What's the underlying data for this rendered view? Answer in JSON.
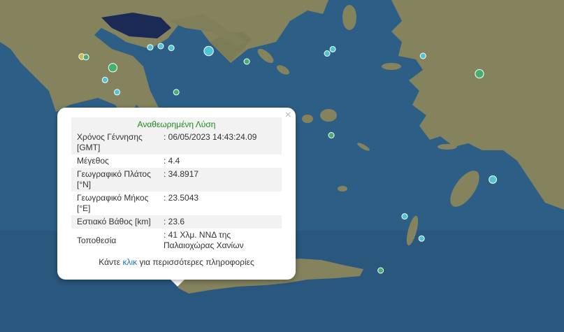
{
  "map": {
    "sea_color": "#2d5f86",
    "land_color": "#8a8863",
    "land_dark_color": "#6e7450"
  },
  "markers": [
    {
      "lon": 22.96,
      "lat": 38.17,
      "color": "#4ec4d8",
      "mag": 3.6
    },
    {
      "lon": 22.13,
      "lat": 38.23,
      "color": "#4ec4d8",
      "mag": 2.6
    },
    {
      "lon": 22.28,
      "lat": 38.25,
      "color": "#4ec4d8",
      "mag": 2.4
    },
    {
      "lon": 22.43,
      "lat": 38.22,
      "color": "#4ec4d8",
      "mag": 2.4
    },
    {
      "lon": 21.16,
      "lat": 38.08,
      "color": "#c8b84a",
      "mag": 2.8
    },
    {
      "lon": 21.22,
      "lat": 38.07,
      "color": "#43b06f",
      "mag": 2.6
    },
    {
      "lon": 21.6,
      "lat": 37.9,
      "color": "#43b06f",
      "mag": 3.4
    },
    {
      "lon": 21.49,
      "lat": 37.7,
      "color": "#4ec4d8",
      "mag": 2.4
    },
    {
      "lon": 22.5,
      "lat": 37.5,
      "color": "#43b06f",
      "mag": 2.4
    },
    {
      "lon": 21.66,
      "lat": 37.5,
      "color": "#4ec4d8",
      "mag": 2.4
    },
    {
      "lon": 21.35,
      "lat": 37.12,
      "color": "#43b06f",
      "mag": 2.4
    },
    {
      "lon": 23.5,
      "lat": 38.0,
      "color": "#43b06f",
      "mag": 2.4
    },
    {
      "lon": 24.64,
      "lat": 38.13,
      "color": "#4ec4d8",
      "mag": 2.6
    },
    {
      "lon": 24.72,
      "lat": 38.2,
      "color": "#4ec4d8",
      "mag": 2.6
    },
    {
      "lon": 26.0,
      "lat": 38.09,
      "color": "#4ec4d8",
      "mag": 2.4
    },
    {
      "lon": 26.8,
      "lat": 37.8,
      "color": "#43b06f",
      "mag": 3.4
    },
    {
      "lon": 26.99,
      "lat": 36.08,
      "color": "#4ec4d8",
      "mag": 3.2
    },
    {
      "lon": 25.74,
      "lat": 35.48,
      "color": "#4ec4d8",
      "mag": 2.4
    },
    {
      "lon": 25.98,
      "lat": 35.12,
      "color": "#4ec4d8",
      "mag": 2.4
    },
    {
      "lon": 25.4,
      "lat": 34.6,
      "color": "#43b06f",
      "mag": 2.4
    },
    {
      "lon": 20.95,
      "lat": 34.81,
      "color": "#c8b84a",
      "mag": 3.2
    },
    {
      "lon": 23.37,
      "lat": 34.83,
      "color": "#4ec4d8",
      "mag": 3.0
    },
    {
      "lon": 23.5043,
      "lat": 34.8917,
      "color": "#43b06f",
      "mag": 4.4
    },
    {
      "lon": 23.65,
      "lat": 34.79,
      "color": "#c8b84a",
      "mag": 2.4
    },
    {
      "lon": 24.7,
      "lat": 36.8,
      "color": "#43b06f",
      "mag": 2.4
    },
    {
      "lon": 23.2,
      "lat": 37.0,
      "color": "#43b06f",
      "mag": 2.4
    }
  ],
  "popup": {
    "title": "Αναθεωρημένη Λύση",
    "close_symbol": "×",
    "rows": [
      {
        "label": "Χρόνος Γέννησης [GMT]",
        "value": ": 06/05/2023 14:43:24.09"
      },
      {
        "label": "Μέγεθος",
        "value": ": 4.4"
      },
      {
        "label": "Γεωγραφικό Πλάτος [°N]",
        "value": ": 34.8917"
      },
      {
        "label": "Γεωγραφικό Μήκος [°E]",
        "value": ": 23.5043"
      },
      {
        "label": "Εστιακό Βάθος [km]",
        "value": ": 23.6"
      },
      {
        "label": "Τοποθεσία",
        "value": ": 41 Χλμ. ΝΝΔ της Παλαιοχώρας Χανίων"
      }
    ],
    "more_prefix": "Κάντε",
    "more_link": "κλικ",
    "more_suffix": "για περισσότερες πληροφορίες"
  }
}
